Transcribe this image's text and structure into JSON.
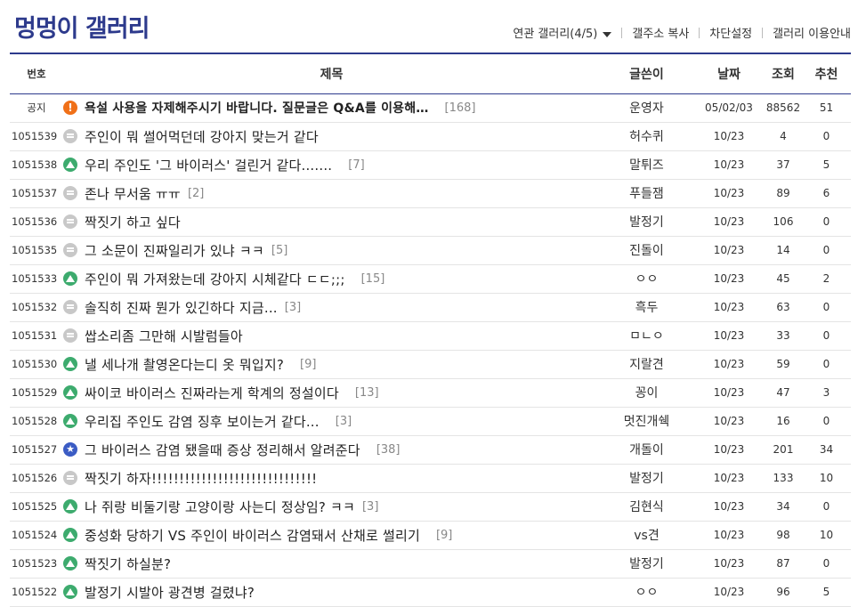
{
  "gallery": {
    "title": "멍멍이 갤러리",
    "nav": [
      {
        "label": "연관 갤러리(4/5)",
        "has_caret": true
      },
      {
        "label": "갤주소 복사"
      },
      {
        "label": "차단설정"
      },
      {
        "label": "갤러리 이용안내"
      }
    ]
  },
  "columns": {
    "num": "번호",
    "title": "제목",
    "writer": "글쓴이",
    "date": "날짜",
    "views": "조회",
    "recommend": "추천"
  },
  "colors": {
    "accent": "#2d3a8c",
    "notice_icon": "#f07018",
    "image_icon": "#3dab6e",
    "recommend_icon": "#3b5cc4",
    "text_icon": "#c8c8c8"
  },
  "posts": [
    {
      "num": "공지",
      "icon": "notice-icon",
      "title": "욕설 사용을 자제해주시기 바랍니다. 질문글은 Q&A를 이용해…",
      "reply": "[168]",
      "writer": "운영자",
      "date": "05/02/03",
      "views": "88562",
      "recommend": "51"
    },
    {
      "num": "1051539",
      "icon": "text-post-icon",
      "title": "주인이 뭐 썰어먹던데 강아지 맞는거 같다",
      "reply": "",
      "writer": "허수퀴",
      "date": "10/23",
      "views": "4",
      "recommend": "0"
    },
    {
      "num": "1051538",
      "icon": "image-post-icon",
      "title": "우리 주인도 '그 바이러스' 걸린거 같다.......",
      "reply": "[7]",
      "writer": "말튀즈",
      "date": "10/23",
      "views": "37",
      "recommend": "5"
    },
    {
      "num": "1051537",
      "icon": "text-post-icon",
      "title": "존나 무서움 ㅠㅠ",
      "reply": "[2]",
      "writer": "푸들잼",
      "date": "10/23",
      "views": "89",
      "recommend": "6"
    },
    {
      "num": "1051536",
      "icon": "text-post-icon",
      "title": "짝짓기  하고  싶다",
      "reply": "",
      "writer": "발정기",
      "date": "10/23",
      "views": "106",
      "recommend": "0"
    },
    {
      "num": "1051535",
      "icon": "text-post-icon",
      "title": "그 소문이 진짜일리가 있냐 ㅋㅋ",
      "reply": "[5]",
      "writer": "진돌이",
      "date": "10/23",
      "views": "14",
      "recommend": "0"
    },
    {
      "num": "1051533",
      "icon": "image-post-icon",
      "title": "주인이 뭐 가져왔는데 강아지 시체같다 ㄷㄷ;;;",
      "reply": "[15]",
      "writer": "ㅇㅇ",
      "date": "10/23",
      "views": "45",
      "recommend": "2"
    },
    {
      "num": "1051532",
      "icon": "text-post-icon",
      "title": "솔직히 진짜 뭔가 있긴하다 지금...",
      "reply": "[3]",
      "writer": "흑두",
      "date": "10/23",
      "views": "63",
      "recommend": "0"
    },
    {
      "num": "1051531",
      "icon": "text-post-icon",
      "title": "쌉소리좀 그만해 시발럼들아",
      "reply": "",
      "writer": "ㅁㄴㅇ",
      "date": "10/23",
      "views": "33",
      "recommend": "0"
    },
    {
      "num": "1051530",
      "icon": "image-post-icon",
      "title": "낼 세나개 촬영온다는디 옷 뭐입지?",
      "reply": "[9]",
      "writer": "지랄견",
      "date": "10/23",
      "views": "59",
      "recommend": "0"
    },
    {
      "num": "1051529",
      "icon": "image-post-icon",
      "title": "싸이코 바이러스 진짜라는게 학계의 정설이다",
      "reply": "[13]",
      "writer": "꽁이",
      "date": "10/23",
      "views": "47",
      "recommend": "3"
    },
    {
      "num": "1051528",
      "icon": "image-post-icon",
      "title": "우리집 주인도 감염 징후 보이는거 같다...",
      "reply": "[3]",
      "writer": "멋진개쉑",
      "date": "10/23",
      "views": "16",
      "recommend": "0"
    },
    {
      "num": "1051527",
      "icon": "recommend-post-icon",
      "title": "그 바이러스 감염 됐을때 증상 정리해서 알려준다",
      "reply": "[38]",
      "writer": "개돌이",
      "date": "10/23",
      "views": "201",
      "recommend": "34"
    },
    {
      "num": "1051526",
      "icon": "text-post-icon",
      "title": "짝짓기 하자!!!!!!!!!!!!!!!!!!!!!!!!!!!!!!",
      "reply": "",
      "writer": "발정기",
      "date": "10/23",
      "views": "133",
      "recommend": "10"
    },
    {
      "num": "1051525",
      "icon": "image-post-icon",
      "title": "나 쥐랑 비둘기랑 고양이랑 사는디 정상임? ㅋㅋ",
      "reply": "[3]",
      "writer": "김현식",
      "date": "10/23",
      "views": "34",
      "recommend": "0"
    },
    {
      "num": "1051524",
      "icon": "image-post-icon",
      "title": "중성화 당하기 VS 주인이 바이러스 감염돼서 산채로 썰리기",
      "reply": "[9]",
      "writer": "vs견",
      "date": "10/23",
      "views": "98",
      "recommend": "10"
    },
    {
      "num": "1051523",
      "icon": "image-post-icon",
      "title": "짝짓기  하실분?",
      "reply": "",
      "writer": "발정기",
      "date": "10/23",
      "views": "87",
      "recommend": "0"
    },
    {
      "num": "1051522",
      "icon": "image-post-icon",
      "title": "발정기 시발아 광견병 걸렸냐?",
      "reply": "",
      "writer": "ㅇㅇ",
      "date": "10/23",
      "views": "96",
      "recommend": "5"
    }
  ]
}
